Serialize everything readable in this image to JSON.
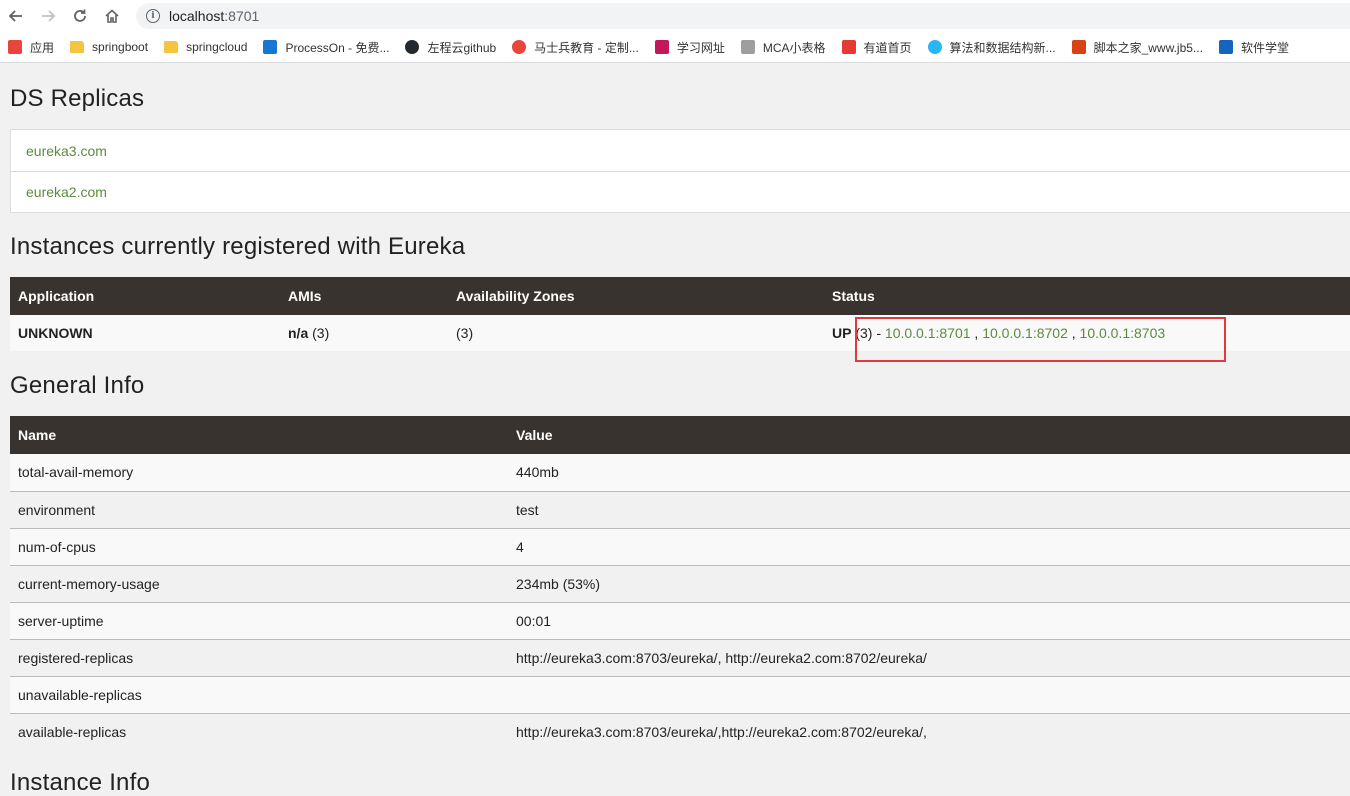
{
  "browser": {
    "url_host": "localhost",
    "url_port": ":8701",
    "bookmarks": [
      {
        "label": "应用",
        "icon": "apps-grid-icon",
        "color": "#e8453c"
      },
      {
        "label": "springboot",
        "icon": "folder-icon",
        "color": "#f4c542"
      },
      {
        "label": "springcloud",
        "icon": "folder-icon",
        "color": "#f4c542"
      },
      {
        "label": "ProcessOn - 免费...",
        "icon": "processon-icon",
        "color": "#1677d2"
      },
      {
        "label": "左程云github",
        "icon": "github-icon",
        "color": "#24292e"
      },
      {
        "label": "马士兵教育 - 定制...",
        "icon": "msb-icon",
        "color": "#e8453c"
      },
      {
        "label": "学习网址",
        "icon": "bookmark-icon",
        "color": "#c2185b"
      },
      {
        "label": "MCA小表格",
        "icon": "sheet-icon",
        "color": "#9e9e9e"
      },
      {
        "label": "有道首页",
        "icon": "youdao-icon",
        "color": "#e53935"
      },
      {
        "label": "算法和数据结构新...",
        "icon": "algo-icon",
        "color": "#29b6f6"
      },
      {
        "label": "脚本之家_www.jb5...",
        "icon": "jb51-icon",
        "color": "#d84315"
      },
      {
        "label": "软件学堂",
        "icon": "software-icon",
        "color": "#1565c0"
      }
    ]
  },
  "ds_replicas": {
    "title": "DS Replicas",
    "items": [
      "eureka3.com",
      "eureka2.com"
    ]
  },
  "instances": {
    "title": "Instances currently registered with Eureka",
    "headers": [
      "Application",
      "AMIs",
      "Availability Zones",
      "Status"
    ],
    "row": {
      "application": "UNKNOWN",
      "amis_bold": "n/a",
      "amis_count": " (3)",
      "zones": "(3)",
      "status_bold": "UP",
      "status_count": " (3) - ",
      "links": [
        "10.0.0.1:8701",
        "10.0.0.1:8702",
        "10.0.0.1:8703"
      ],
      "separator": " , "
    }
  },
  "general_info": {
    "title": "General Info",
    "headers": [
      "Name",
      "Value"
    ],
    "rows": [
      {
        "name": "total-avail-memory",
        "value": "440mb"
      },
      {
        "name": "environment",
        "value": "test"
      },
      {
        "name": "num-of-cpus",
        "value": "4"
      },
      {
        "name": "current-memory-usage",
        "value": "234mb (53%)"
      },
      {
        "name": "server-uptime",
        "value": "00:01"
      },
      {
        "name": "registered-replicas",
        "value": "http://eureka3.com:8703/eureka/, http://eureka2.com:8702/eureka/"
      },
      {
        "name": "unavailable-replicas",
        "value": ""
      },
      {
        "name": "available-replicas",
        "value": "http://eureka3.com:8703/eureka/,http://eureka2.com:8702/eureka/,"
      }
    ]
  },
  "instance_info": {
    "title": "Instance Info"
  },
  "colors": {
    "link_green": "#5c8b3d",
    "header_dark": "#38332e",
    "highlight_red": "#e0393e"
  }
}
